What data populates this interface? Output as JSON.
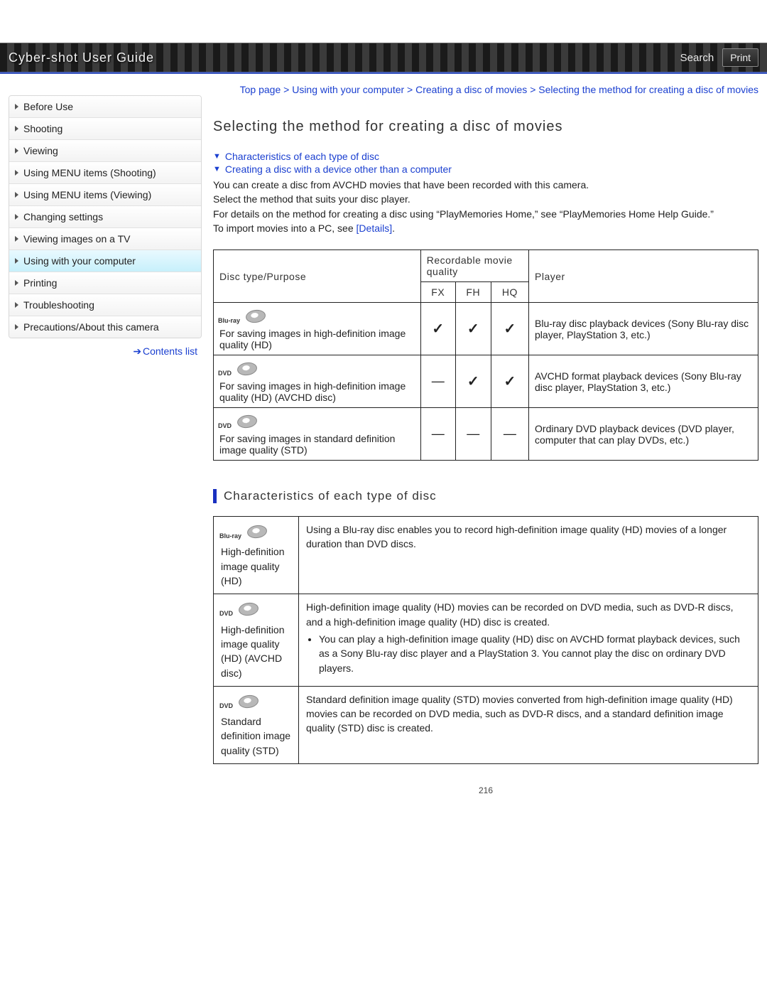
{
  "header": {
    "title": "Cyber-shot User Guide",
    "search_label": "Search",
    "print_label": "Print"
  },
  "sidebar": {
    "items": [
      {
        "label": "Before Use"
      },
      {
        "label": "Shooting"
      },
      {
        "label": "Viewing"
      },
      {
        "label": "Using MENU items (Shooting)"
      },
      {
        "label": "Using MENU items (Viewing)"
      },
      {
        "label": "Changing settings"
      },
      {
        "label": "Viewing images on a TV"
      },
      {
        "label": "Using with your computer"
      },
      {
        "label": "Printing"
      },
      {
        "label": "Troubleshooting"
      },
      {
        "label": "Precautions/About this camera"
      }
    ],
    "active_index": 7,
    "contents_list_label": "Contents list"
  },
  "breadcrumb": {
    "parts": [
      "Top page",
      "Using with your computer",
      "Creating a disc of movies",
      "Selecting the method for creating a disc of movies"
    ],
    "sep": " > "
  },
  "main": {
    "title": "Selecting the method for creating a disc of movies",
    "jump1": "Characteristics of each type of disc",
    "jump2": "Creating a disc with a device other than a computer",
    "para1": "You can create a disc from AVCHD movies that have been recorded with this camera.",
    "para2": "Select the method that suits your disc player.",
    "para3": "For details on the method for creating a disc using “PlayMemories Home,” see “PlayMemories Home Help Guide.”",
    "para4_prefix": "To import movies into a PC, see ",
    "para4_link": "[Details]",
    "para4_suffix": "."
  },
  "table1": {
    "headers": {
      "col1": "Disc type/Purpose",
      "col2": "Recordable movie quality",
      "col3": "Player",
      "fx": "FX",
      "fh": "FH",
      "hq": "HQ"
    },
    "rows": [
      {
        "disc_brand": "Blu-ray",
        "purpose": "For saving images in high-definition image quality (HD)",
        "fx": "✓",
        "fh": "✓",
        "hq": "✓",
        "player": "Blu-ray disc playback devices (Sony Blu-ray disc player, PlayStation 3, etc.)"
      },
      {
        "disc_brand": "DVD",
        "purpose": "For saving images in high-definition image quality (HD) (AVCHD disc)",
        "fx": "—",
        "fh": "✓",
        "hq": "✓",
        "player": "AVCHD format playback devices (Sony Blu-ray disc player, PlayStation 3, etc.)"
      },
      {
        "disc_brand": "DVD",
        "purpose": "For saving images in standard definition image quality (STD)",
        "fx": "—",
        "fh": "—",
        "hq": "—",
        "player": "Ordinary DVD playback devices (DVD player, computer that can play DVDs, etc.)"
      }
    ]
  },
  "section2_title": "Characteristics of each type of disc",
  "table2": {
    "rows": [
      {
        "disc_brand": "Blu-ray",
        "type_label": "High-definition image quality (HD)",
        "desc": "Using a Blu-ray disc enables you to record high-definition image quality (HD) movies of a longer duration than DVD discs."
      },
      {
        "disc_brand": "DVD",
        "type_label": "High-definition image quality (HD) (AVCHD disc)",
        "desc": "High-definition image quality (HD) movies can be recorded on DVD media, such as DVD-R discs, and a high-definition image quality (HD) disc is created.",
        "bullet": "You can play a high-definition image quality (HD) disc on AVCHD format playback devices, such as a Sony Blu-ray disc player and a PlayStation 3. You cannot play the disc on ordinary DVD players."
      },
      {
        "disc_brand": "DVD",
        "type_label": "Standard definition image quality (STD)",
        "desc": "Standard definition image quality (STD) movies converted from high-definition image quality (HD) movies can be recorded on DVD media, such as DVD-R discs, and a standard definition image quality (STD) disc is created."
      }
    ]
  },
  "page_number": "216"
}
